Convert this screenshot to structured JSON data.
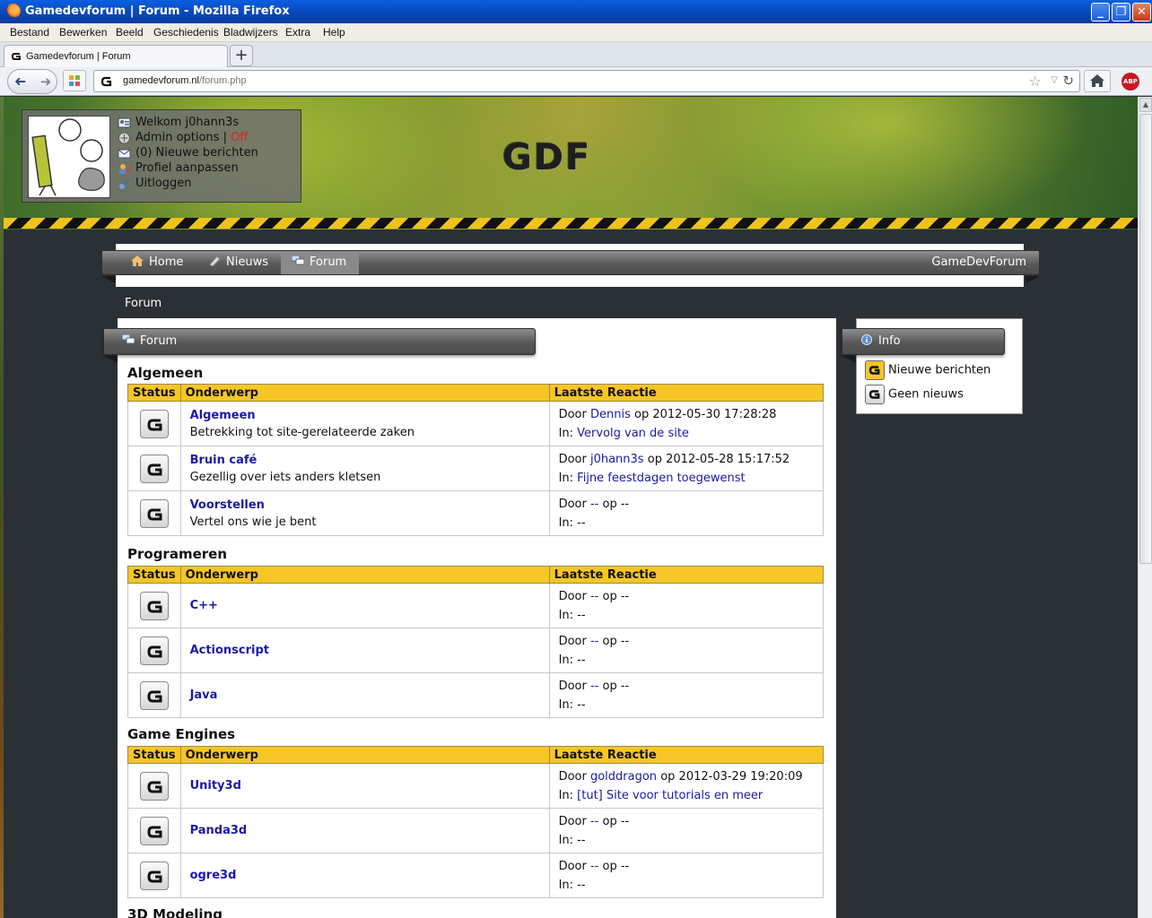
{
  "window": {
    "title": "Gamedevforum | Forum - Mozilla Firefox",
    "minimize": "_",
    "restore": "❐",
    "close": "✕"
  },
  "menu": [
    "Bestand",
    "Bewerken",
    "Beeld",
    "Geschiedenis",
    "Bladwijzers",
    "Extra",
    "Help"
  ],
  "tab": {
    "label": "Gamedevforum | Forum",
    "new_tab": "+"
  },
  "address": {
    "domain": "gamedevforum.nl",
    "path": "/forum.php"
  },
  "toolbar": {
    "back": "➜",
    "forward": "➜",
    "star": "☆",
    "dropdown": "▽",
    "reload": "↻",
    "adblock": "ABP"
  },
  "header": {
    "logo": "GDF",
    "user": {
      "welcome": "Welkom j0hann3s",
      "admin": "Admin options",
      "separator": " | ",
      "admin_state": "Off",
      "messages": "(0) Nieuwe berichten",
      "profile": "Profiel aanpassen",
      "logout": "Uitloggen"
    }
  },
  "nav": {
    "items": [
      "Home",
      "Nieuws",
      "Forum"
    ],
    "active": "Forum",
    "site_name": "GameDevForum"
  },
  "breadcrumb": "Forum",
  "forum": {
    "panel_title": "Forum",
    "headers": {
      "status": "Status",
      "topic": "Onderwerp",
      "last": "Laatste Reactie"
    },
    "labels": {
      "by": "Door",
      "on": "op",
      "in": "In:"
    },
    "categories": [
      {
        "name": "Algemeen",
        "rows": [
          {
            "title": "Algemeen",
            "desc": "Betrekking tot site-gerelateerde zaken",
            "last_user": "Dennis",
            "last_date": "2012-05-30 17:28:28",
            "last_topic": "Vervolg van de site"
          },
          {
            "title": "Bruin café",
            "desc": "Gezellig over iets anders kletsen",
            "last_user": "j0hann3s",
            "last_date": "2012-05-28 15:17:52",
            "last_topic": "Fijne feestdagen toegewenst"
          },
          {
            "title": "Voorstellen",
            "desc": "Vertel ons wie je bent",
            "last_user": "--",
            "last_date": "--",
            "last_topic": "--"
          }
        ]
      },
      {
        "name": "Programeren",
        "rows": [
          {
            "title": "C++",
            "desc": "",
            "last_user": "--",
            "last_date": "--",
            "last_topic": "--"
          },
          {
            "title": "Actionscript",
            "desc": "",
            "last_user": "--",
            "last_date": "--",
            "last_topic": "--"
          },
          {
            "title": "Java",
            "desc": "",
            "last_user": "--",
            "last_date": "--",
            "last_topic": "--"
          }
        ]
      },
      {
        "name": "Game Engines",
        "rows": [
          {
            "title": "Unity3d",
            "desc": "",
            "last_user": "golddragon",
            "last_date": "2012-03-29 19:20:09",
            "last_topic": "[tut] Site voor tutorials en meer"
          },
          {
            "title": "Panda3d",
            "desc": "",
            "last_user": "--",
            "last_date": "--",
            "last_topic": "--"
          },
          {
            "title": "ogre3d",
            "desc": "",
            "last_user": "--",
            "last_date": "--",
            "last_topic": "--"
          }
        ]
      },
      {
        "name": "3D Modeling",
        "rows": []
      }
    ]
  },
  "info": {
    "title": "Info",
    "new_posts": "Nieuwe berichten",
    "no_news": "Geen nieuws"
  },
  "colors": {
    "accent": "#f6c626",
    "link": "#1a1aa6",
    "off": "#e02020",
    "page_bg": "#2b3035"
  }
}
